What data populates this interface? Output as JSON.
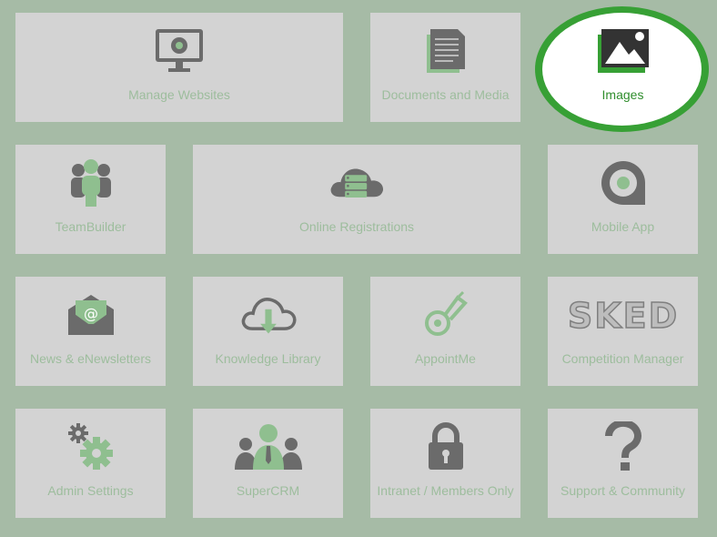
{
  "tiles": {
    "manage_websites": "Manage Websites",
    "documents_media": "Documents and Media",
    "images": "Images",
    "teambuilder": "TeamBuilder",
    "online_registrations": "Online Registrations",
    "mobile_app": "Mobile App",
    "news": "News & eNewsletters",
    "knowledge_library": "Knowledge Library",
    "appointme": "AppointMe",
    "competition_manager": "Competition Manager",
    "admin_settings": "Admin Settings",
    "supercrm": "SuperCRM",
    "intranet": "Intranet / Members Only",
    "support": "Support & Community"
  },
  "logos": {
    "sked": "SKED"
  },
  "colors": {
    "background": "#a6bba6",
    "tile": "#d3d3d3",
    "label": "#9dbd9d",
    "icon_dark": "#6b6b6b",
    "icon_green": "#8fbf8f",
    "highlight_ring": "#37a035",
    "highlight_label": "#2f8d2c"
  }
}
